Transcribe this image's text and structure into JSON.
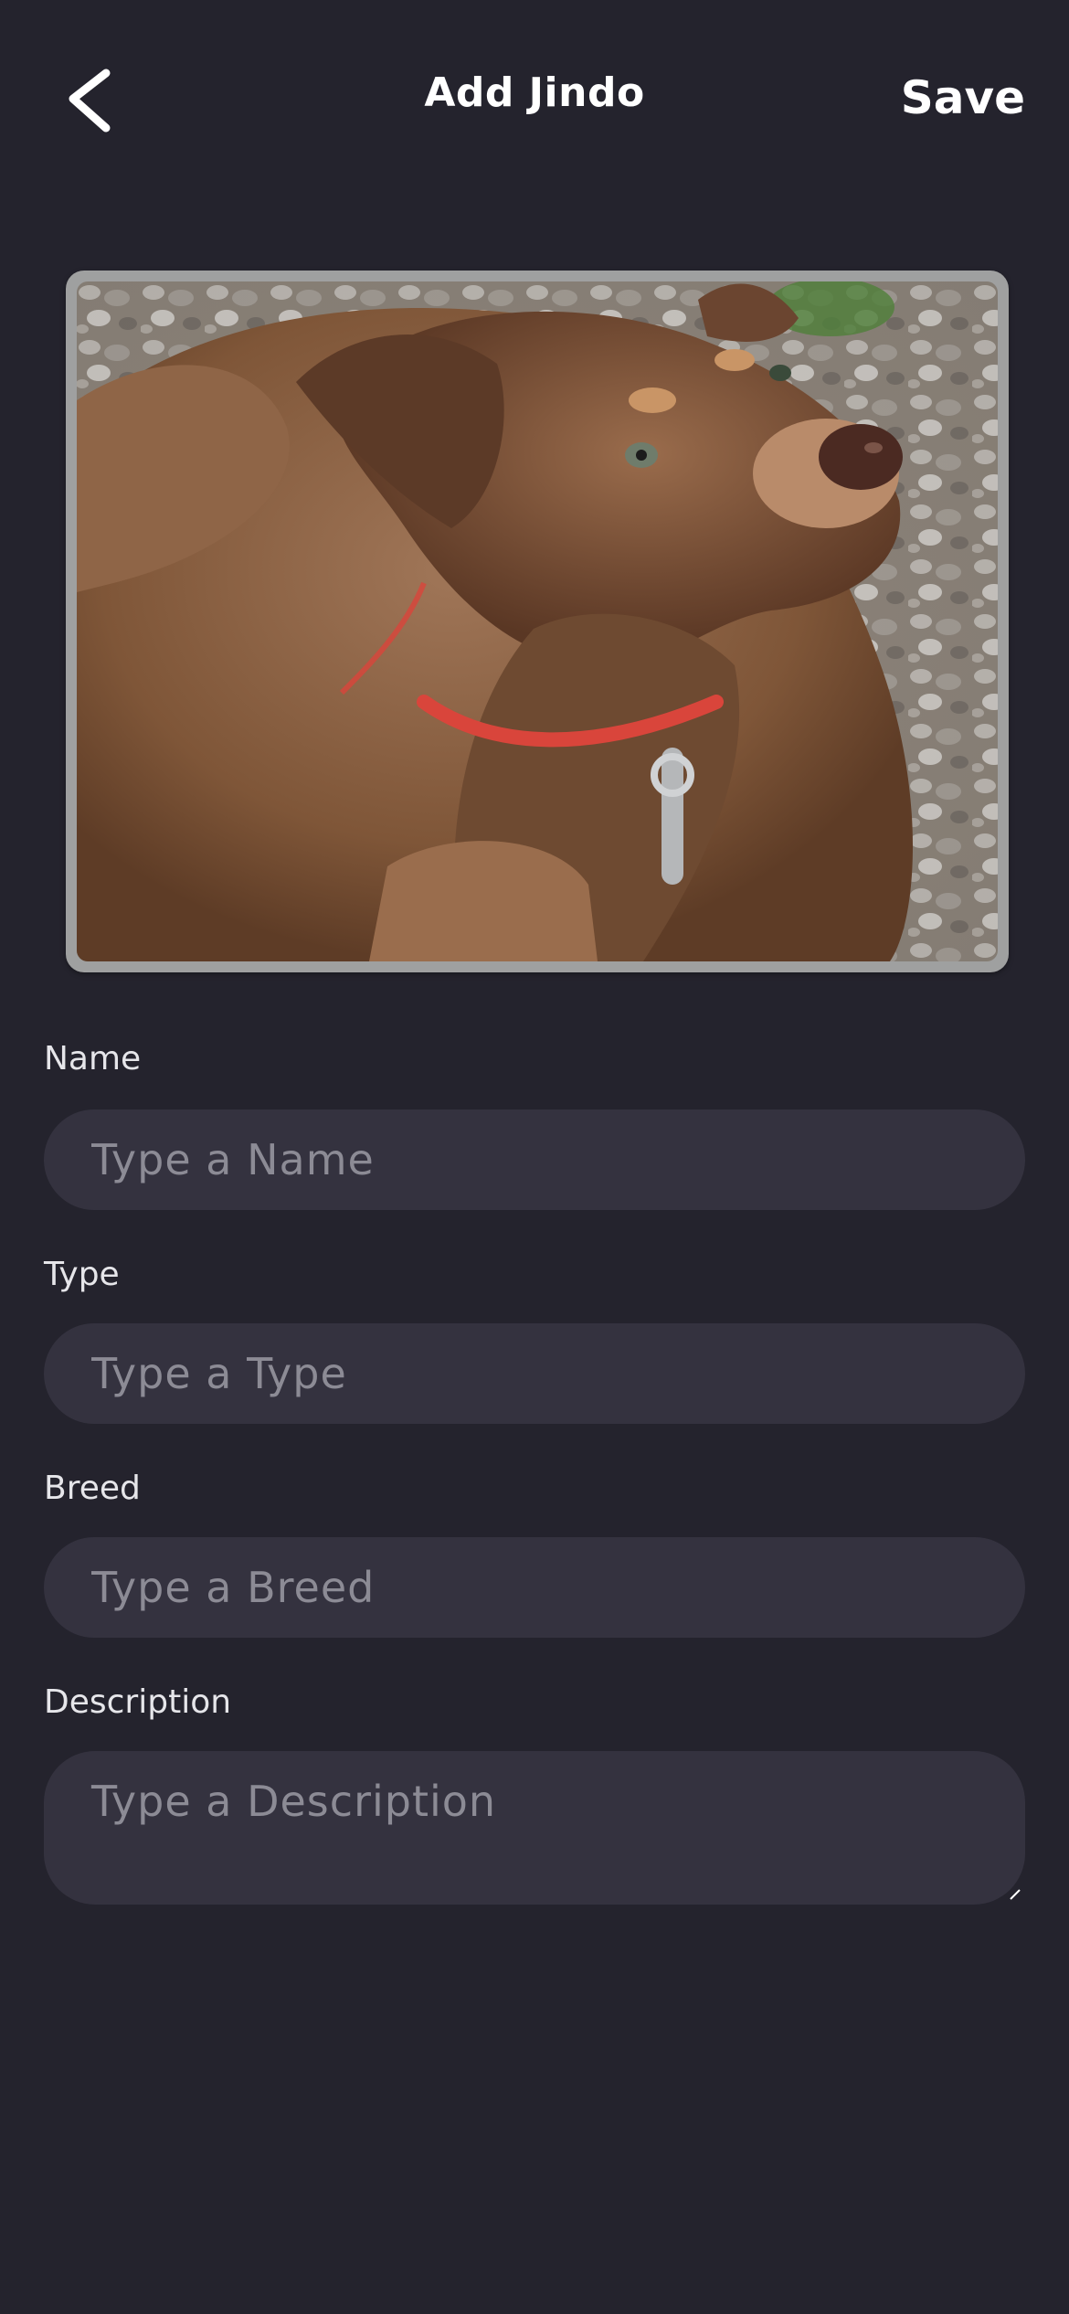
{
  "header": {
    "title": "Add Jindo",
    "save_label": "Save",
    "back_icon": "chevron-left-icon"
  },
  "photo": {
    "description_icon": "dog-photo"
  },
  "form": {
    "name": {
      "label": "Name",
      "placeholder": "Type a Name",
      "value": ""
    },
    "type": {
      "label": "Type",
      "placeholder": "Type a Type",
      "value": ""
    },
    "breed": {
      "label": "Breed",
      "placeholder": "Type a Breed",
      "value": ""
    },
    "description": {
      "label": "Description",
      "placeholder": "Type a Description",
      "value": ""
    }
  },
  "colors": {
    "background": "#24232d",
    "input_background": "#34323f",
    "placeholder": "#8c8b95",
    "text": "#ffffff"
  }
}
